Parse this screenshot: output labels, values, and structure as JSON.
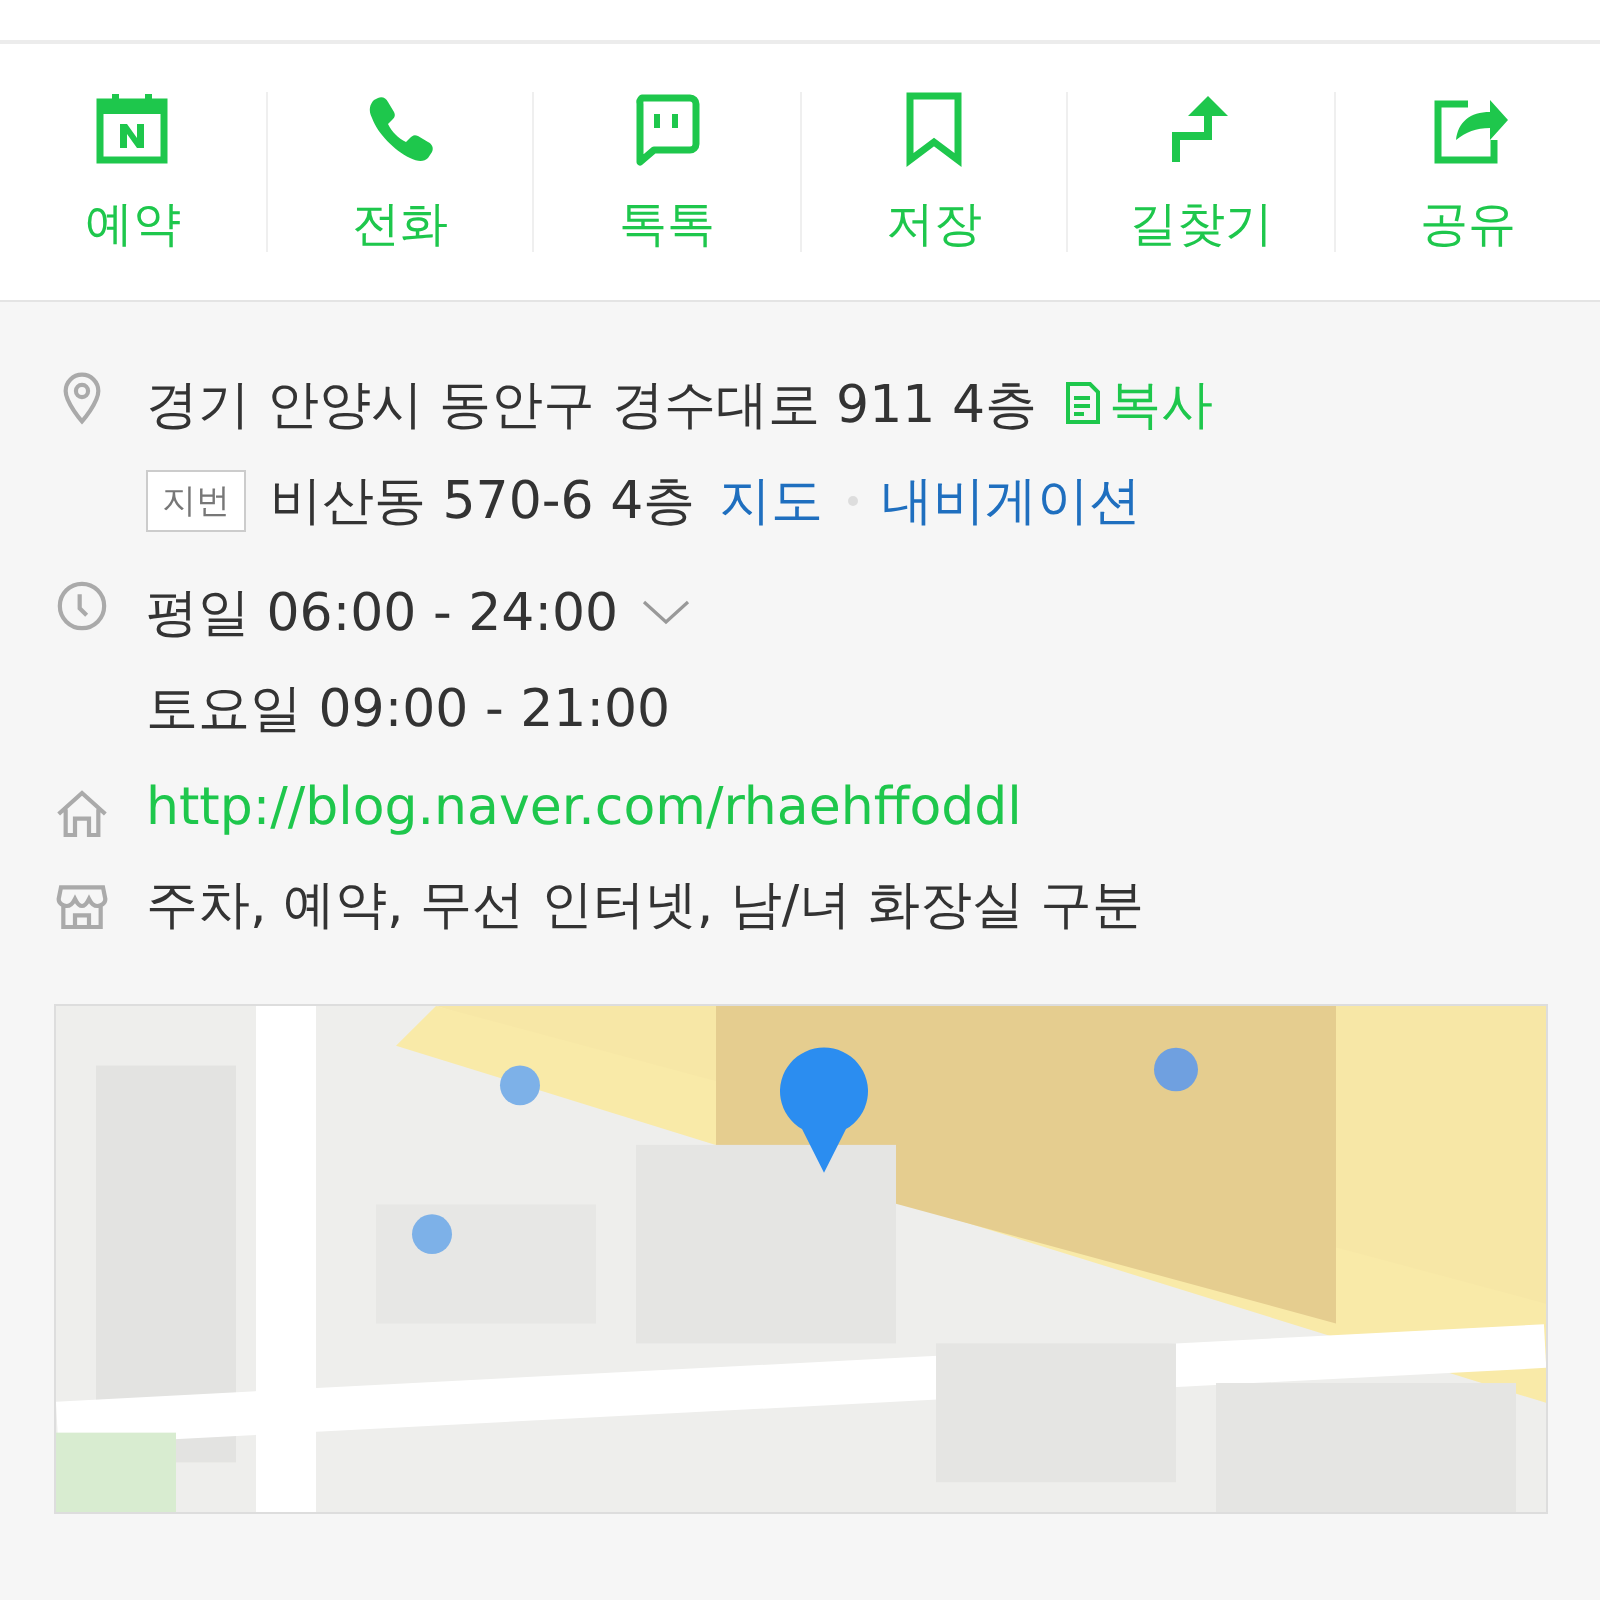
{
  "actions": [
    {
      "label": "예약"
    },
    {
      "label": "전화"
    },
    {
      "label": "톡톡"
    },
    {
      "label": "저장"
    },
    {
      "label": "길찾기"
    },
    {
      "label": "공유"
    }
  ],
  "address": {
    "road": "경기 안양시 동안구 경수대로 911 4층",
    "copy_label": "복사",
    "jibun_tag": "지번",
    "jibun": "비산동 570-6 4층",
    "map_link": "지도",
    "nav_link": "내비게이션"
  },
  "hours": {
    "expanded": false,
    "lines": [
      "평일 06:00 - 24:00",
      "토요일 09:00 - 21:00"
    ]
  },
  "website": "http://blog.naver.com/rhaehffoddl",
  "amenities": "주차, 예약, 무선 인터넷, 남/녀 화장실 구분"
}
